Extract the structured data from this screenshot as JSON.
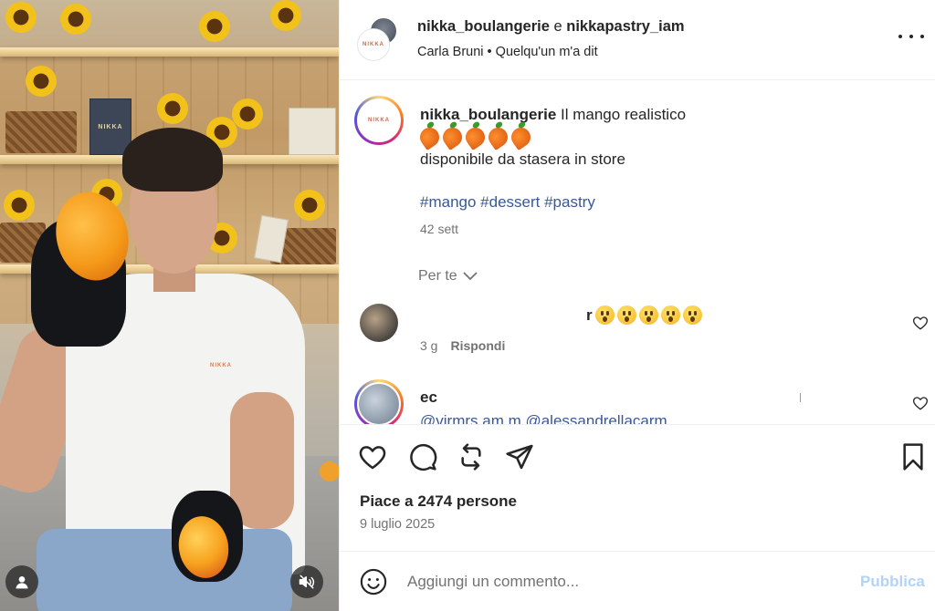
{
  "header": {
    "user1": "nikka_boulangerie",
    "conjunction": "e",
    "user2": "nikkapastry_iam",
    "audio": "Carla Bruni • Quelqu'un m'a dit",
    "logo_text": "NIKKA"
  },
  "caption": {
    "username": "nikka_boulangerie",
    "text": "Il mango realistico",
    "line2": "disponibile da stasera in store",
    "hashtags": "#mango #dessert #pastry",
    "time": "42 sett",
    "emoji_count": 5
  },
  "for_you": "Per te",
  "comments": [
    {
      "text_fragment": "r",
      "emoji_count": 5,
      "time": "3 g",
      "reply": "Rispondi"
    },
    {
      "username_fragment": "ec",
      "mention_fragment": "@virmrs.am.m @alessandrellacarm"
    }
  ],
  "actions": {
    "likes": "Piace a 2474 persone",
    "date": "9 luglio 2025"
  },
  "composer": {
    "placeholder": "Aggiungi un commento...",
    "publish": "Pubblica"
  },
  "media": {
    "box_label": "NIKKA",
    "shirt_logo": "NIKKA"
  },
  "colors": {
    "link": "#385898",
    "muted": "#737373",
    "publish_disabled": "#b3d3fa",
    "text": "#262626"
  }
}
